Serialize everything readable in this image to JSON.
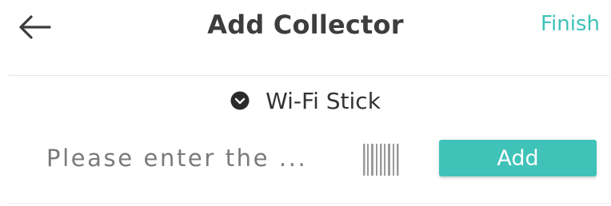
{
  "header": {
    "title": "Add Collector",
    "finish_label": "Finish",
    "back_icon": "arrow-left-icon"
  },
  "collector_type": {
    "selected": "Wi-Fi Stick",
    "icon": "chevron-down-circle-icon"
  },
  "serial_input": {
    "placeholder": "Please enter the ...",
    "value": ""
  },
  "scan_icon": "barcode-scan-icon",
  "add_button": {
    "label": "Add"
  },
  "colors": {
    "accent": "#3fc2b8",
    "title_text": "#3d3d3d",
    "placeholder_text": "#7a7a7a",
    "divider": "#e6e6e6"
  }
}
